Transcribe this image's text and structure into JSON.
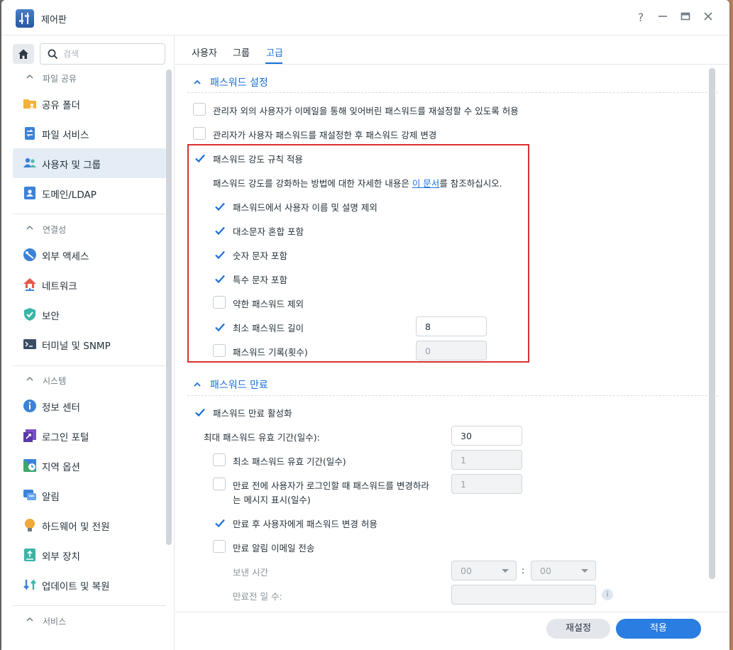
{
  "window": {
    "title": "제어판"
  },
  "search": {
    "placeholder": "검색"
  },
  "sidebar": {
    "sections": [
      {
        "label": "파일 공유"
      },
      {
        "label": "연결성"
      },
      {
        "label": "시스템"
      },
      {
        "label": "서비스"
      }
    ],
    "items": [
      {
        "label": "공유 폴더",
        "icon": "folder-share-icon"
      },
      {
        "label": "파일 서비스",
        "icon": "file-services-icon"
      },
      {
        "label": "사용자 및 그룹",
        "icon": "users-group-icon",
        "active": true
      },
      {
        "label": "도메인/LDAP",
        "icon": "domain-ldap-icon"
      },
      {
        "label": "외부 액세스",
        "icon": "external-access-icon"
      },
      {
        "label": "네트워크",
        "icon": "network-icon"
      },
      {
        "label": "보안",
        "icon": "shield-icon"
      },
      {
        "label": "터미널 및 SNMP",
        "icon": "terminal-icon"
      },
      {
        "label": "정보 센터",
        "icon": "info-center-icon"
      },
      {
        "label": "로그인 포털",
        "icon": "login-portal-icon"
      },
      {
        "label": "지역 옵션",
        "icon": "regional-options-icon"
      },
      {
        "label": "알림",
        "icon": "notification-icon"
      },
      {
        "label": "하드웨어 및 전원",
        "icon": "hardware-power-icon"
      },
      {
        "label": "외부 장치",
        "icon": "external-devices-icon"
      },
      {
        "label": "업데이트 및 복원",
        "icon": "update-restore-icon"
      }
    ]
  },
  "tabs": [
    {
      "label": "사용자"
    },
    {
      "label": "그룹"
    },
    {
      "label": "고급",
      "active": true
    }
  ],
  "password_settings": {
    "title": "패스워드 설정",
    "allow_reset_by_email": {
      "label": "관리자 외의 사용자가 이메일을 통해 잊어버린 패스워드를 재설정할 수 있도록 허용",
      "checked": false
    },
    "force_change_after_reset": {
      "label": "관리자가 사용자 패스워드를 재설정한 후 패스워드 강제 변경",
      "checked": false
    },
    "apply_strength_rules": {
      "label": "패스워드 강도 규칙 적용",
      "checked": true
    },
    "hint_prefix": "패스워드 강도를 강화하는 방법에 대한 자세한 내용은 ",
    "hint_link": "이 문서",
    "hint_suffix": "를 참조하십시오.",
    "exclude_username": {
      "label": "패스워드에서 사용자 이름 및 설명 제외",
      "checked": true
    },
    "mixed_case": {
      "label": "대소문자 혼합 포함",
      "checked": true
    },
    "numeric": {
      "label": "숫자 문자 포함",
      "checked": true
    },
    "special": {
      "label": "특수 문자 포함",
      "checked": true
    },
    "exclude_weak": {
      "label": "약한 패스워드 제외",
      "checked": false
    },
    "min_length": {
      "label": "최소 패스워드 길이",
      "checked": true,
      "value": "8"
    },
    "history": {
      "label": "패스워드 기록(횟수)",
      "checked": false,
      "value": "0"
    }
  },
  "password_expiration": {
    "title": "패스워드 만료",
    "enable": {
      "label": "패스워드 만료 활성화",
      "checked": true
    },
    "max_age_label": "최대 패스워드 유효 기간(일수):",
    "max_age_value": "30",
    "min_age": {
      "label": "최소 패스워드 유효 기간(일수)",
      "checked": false,
      "value": "1"
    },
    "prompt_before_expiry": {
      "label_line1": "만료 전에 사용자가 로그인할 때 패스워드를 변경하라",
      "label_line2": "는 메시지 표시(일수)",
      "checked": false,
      "value": "1"
    },
    "allow_change_after_expiry": {
      "label": "만료 후 사용자에게 패스워드 변경 허용",
      "checked": true
    },
    "send_email": {
      "label": "만료 알림 이메일 전송",
      "checked": false
    },
    "send_time_label": "보낸 시간",
    "hour": "00",
    "time_separator": ":",
    "minute": "00",
    "days_before_label": "만료전 일 수:",
    "days_before_value": ""
  },
  "footer": {
    "reset_label": "재설정",
    "apply_label": "적용"
  },
  "colors": {
    "accent": "#1a6fd8",
    "highlight_box": "#d8312f",
    "primary_button": "#2a7de1"
  }
}
